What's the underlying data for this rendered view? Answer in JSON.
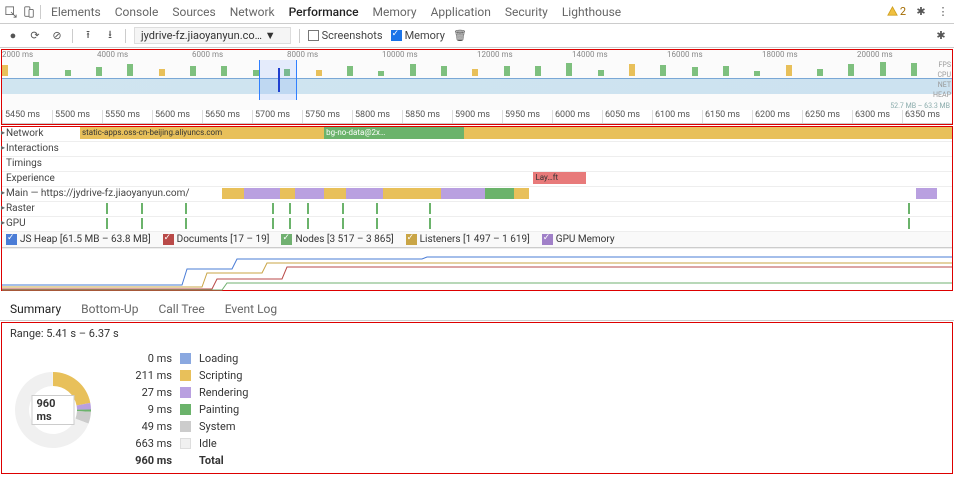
{
  "chart_data": {
    "type": "pie",
    "title": "Range: 5.41 s – 6.37 s",
    "total_ms": 960,
    "series": [
      {
        "name": "Loading",
        "value": 0,
        "color": "#8aa8e0"
      },
      {
        "name": "Scripting",
        "value": 211,
        "color": "#e8c05a"
      },
      {
        "name": "Rendering",
        "value": 27,
        "color": "#b9a0e0"
      },
      {
        "name": "Painting",
        "value": 9,
        "color": "#6bb36b"
      },
      {
        "name": "System",
        "value": 49,
        "color": "#cccccc"
      },
      {
        "name": "Idle",
        "value": 663,
        "color": "#f0f0f0"
      }
    ]
  },
  "top_tabs": [
    "Elements",
    "Console",
    "Sources",
    "Network",
    "Performance",
    "Memory",
    "Application",
    "Security",
    "Lighthouse"
  ],
  "active_top_tab": "Performance",
  "warnings": "2",
  "sub": {
    "recording_dropdown": "jydrive-fz.jiaoyanyun.co…",
    "screenshots_label": "Screenshots",
    "screenshots_on": false,
    "memory_label": "Memory",
    "memory_on": true
  },
  "overview_ticks": [
    "2000 ms",
    "4000 ms",
    "6000 ms",
    "8000 ms",
    "10000 ms",
    "12000 ms",
    "14000 ms",
    "16000 ms",
    "18000 ms",
    "20000 ms"
  ],
  "overview_labels": {
    "fps": "FPS",
    "cpu": "CPU",
    "net": "NET",
    "heap": "HEAP",
    "heap_range": "52.7 MB – 63.3 MB"
  },
  "ruler": [
    "5450 ms",
    "5500 ms",
    "5550 ms",
    "5600 ms",
    "5650 ms",
    "5700 ms",
    "5750 ms",
    "5800 ms",
    "5850 ms",
    "5900 ms",
    "5950 ms",
    "6000 ms",
    "6050 ms",
    "6100 ms",
    "6150 ms",
    "6200 ms",
    "6250 ms",
    "6300 ms",
    "6350 ms"
  ],
  "tracks": {
    "network": "Network",
    "network_items": {
      "a": "static-apps.oss-cn-beijing.aliyuncs.com",
      "b": "bg-no-data@2x…"
    },
    "interactions": "Interactions",
    "timings": "Timings",
    "experience": "Experience",
    "experience_badge": "Lay…ft",
    "main": "Main — https://jydrive-fz.jiaoyanyun.com/",
    "raster": "Raster",
    "gpu": "GPU"
  },
  "mem_legend": {
    "js": {
      "label": "JS Heap",
      "range": "[61.5 MB – 63.8 MB]",
      "color": "#4a7cd6"
    },
    "doc": {
      "label": "Documents",
      "range": "[17 – 19]",
      "color": "#b94a48"
    },
    "node": {
      "label": "Nodes",
      "range": "[3 517 – 3 865]",
      "color": "#70b070"
    },
    "lst": {
      "label": "Listeners",
      "range": "[1 497 – 1 619]",
      "color": "#c9a546"
    },
    "gpu": {
      "label": "GPU Memory",
      "range": "",
      "color": "#a080c8"
    }
  },
  "summary_tabs": [
    "Summary",
    "Bottom-Up",
    "Call Tree",
    "Event Log"
  ],
  "active_summary_tab": "Summary",
  "range_text": "Range: 5.41 s – 6.37 s",
  "categories": [
    {
      "ms": "0 ms",
      "sw": "sw-loading",
      "name": "Loading"
    },
    {
      "ms": "211 ms",
      "sw": "sw-script",
      "name": "Scripting"
    },
    {
      "ms": "27 ms",
      "sw": "sw-render",
      "name": "Rendering"
    },
    {
      "ms": "9 ms",
      "sw": "sw-paint",
      "name": "Painting"
    },
    {
      "ms": "49 ms",
      "sw": "sw-system",
      "name": "System"
    },
    {
      "ms": "663 ms",
      "sw": "sw-idle",
      "name": "Idle"
    }
  ],
  "total": {
    "ms": "960 ms",
    "name": "Total"
  },
  "donut_center": "960 ms"
}
